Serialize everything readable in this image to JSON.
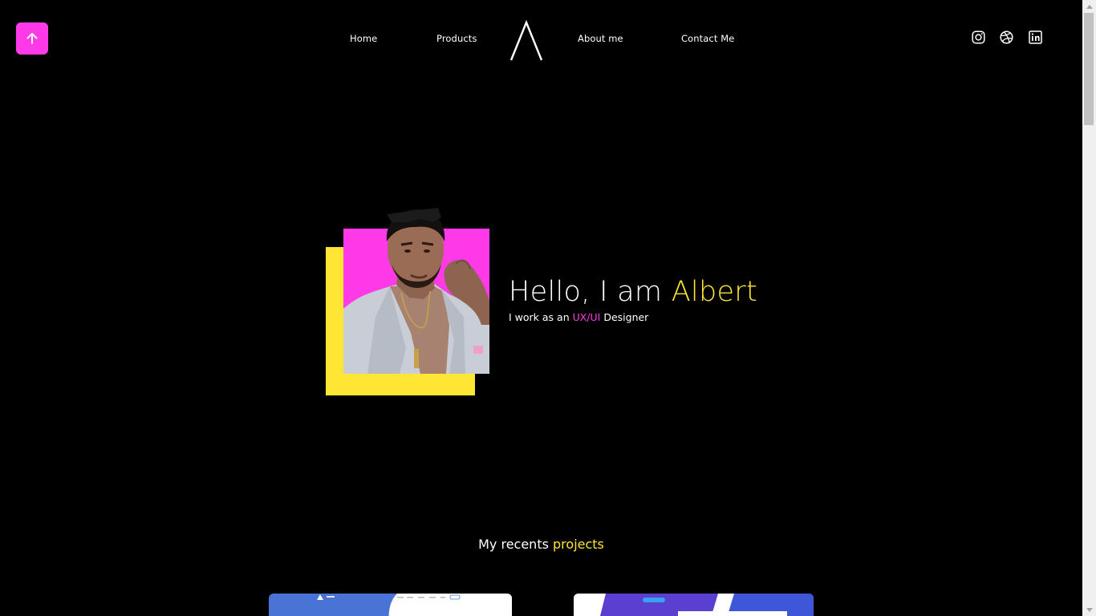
{
  "nav": {
    "items": [
      {
        "label": "Home"
      },
      {
        "label": "Products"
      },
      {
        "label": "About me"
      },
      {
        "label": "Contact Me"
      }
    ]
  },
  "social": {
    "icons": [
      "instagram-icon",
      "dribbble-icon",
      "linkedin-icon"
    ]
  },
  "hero": {
    "greeting": "Hello, I am ",
    "name": "Albert",
    "subtitle_prefix": "I work as an ",
    "role": "UX/UI",
    "subtitle_suffix": " Designer"
  },
  "projects": {
    "title_prefix": "My recents ",
    "title_highlight": "projects"
  },
  "colors": {
    "background": "#000000",
    "accent_pink": "#ff3ae6",
    "accent_yellow": "#ffe534",
    "text": "#ffffff"
  }
}
